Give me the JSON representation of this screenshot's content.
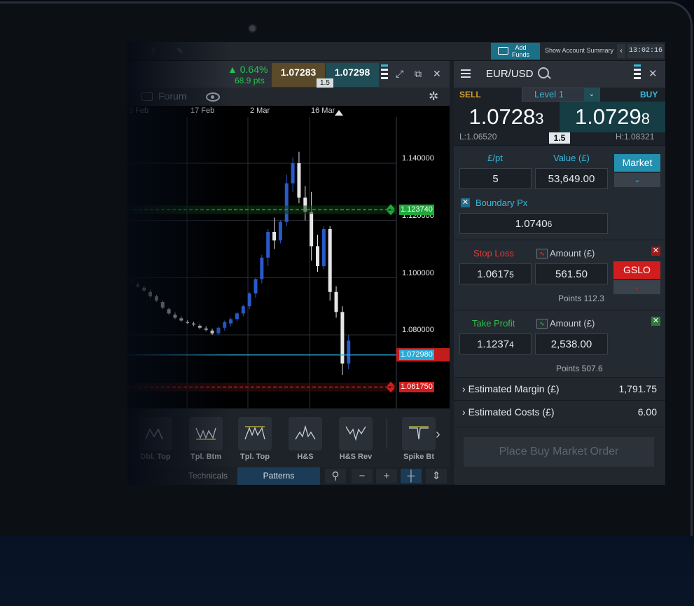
{
  "topbar": {
    "add_funds_line1": "Add",
    "add_funds_line2": "Funds",
    "show_account": "Show Account Summary",
    "back": "‹",
    "clock": "13:02:16"
  },
  "chart_header": {
    "change_pct": "▲ 0.64%",
    "change_pts": "68.9 pts",
    "sell_price": "1.07283",
    "buy_price": "1.07298",
    "spread": "1.5",
    "forum": "Forum"
  },
  "chart_data": {
    "type": "candlestick",
    "x_tick_labels": [
      "3 Feb",
      "17 Feb",
      "2 Mar",
      "16 Mar"
    ],
    "y_tick_labels": [
      "1.140000",
      "1.120000",
      "1.100000",
      "1.080000"
    ],
    "levels": {
      "take_profit": "1.123740",
      "current": "1.072980",
      "stop_loss": "1.061750"
    },
    "colors": {
      "up": "#2a59c9",
      "down": "#e6e6e6",
      "take_profit": "#1fa83a",
      "current": "#29a9d6",
      "stop_loss": "#d11d1d"
    }
  },
  "patterns": {
    "items": [
      {
        "label": "Dbl. Top"
      },
      {
        "label": "Tpl. Btm"
      },
      {
        "label": "Tpl. Top"
      },
      {
        "label": "H&S"
      },
      {
        "label": "H&S Rev"
      },
      {
        "label": "Spike Bt"
      }
    ]
  },
  "chart_footer": {
    "tab_technicals": "Technicals",
    "tab_patterns": "Patterns",
    "minus": "−",
    "plus": "+"
  },
  "ticket": {
    "symbol": "EUR/USD",
    "sell_label": "SELL",
    "buy_label": "BUY",
    "level": "Level 1",
    "sell_main": "1.0728",
    "sell_pip": "3",
    "buy_main": "1.0729",
    "buy_pip": "8",
    "low": "L:1.06520",
    "high": "H:1.08321",
    "spread": "1.5",
    "per_pt_label": "£/pt",
    "value_label": "Value (£)",
    "per_pt": "5",
    "value": "53,649.00",
    "market_btn": "Market",
    "boundary_label": "Boundary Px",
    "boundary_main": "1.0740",
    "boundary_pip": "6",
    "stop_loss_label": "Stop Loss",
    "amount_label": "Amount (£)",
    "stop_main": "1.0617",
    "stop_pip": "5",
    "stop_amount": "561.50",
    "gslo_btn": "GSLO",
    "stop_points": "Points 112.3",
    "take_profit_label": "Take Profit",
    "tp_main": "1.1237",
    "tp_pip": "4",
    "tp_amount": "2,538.00",
    "tp_points": "Points 507.6",
    "est_margin_label": "Estimated Margin (£)",
    "est_margin": "1,791.75",
    "est_costs_label": "Estimated Costs (£)",
    "est_costs": "6.00",
    "place_order": "Place Buy Market Order"
  }
}
